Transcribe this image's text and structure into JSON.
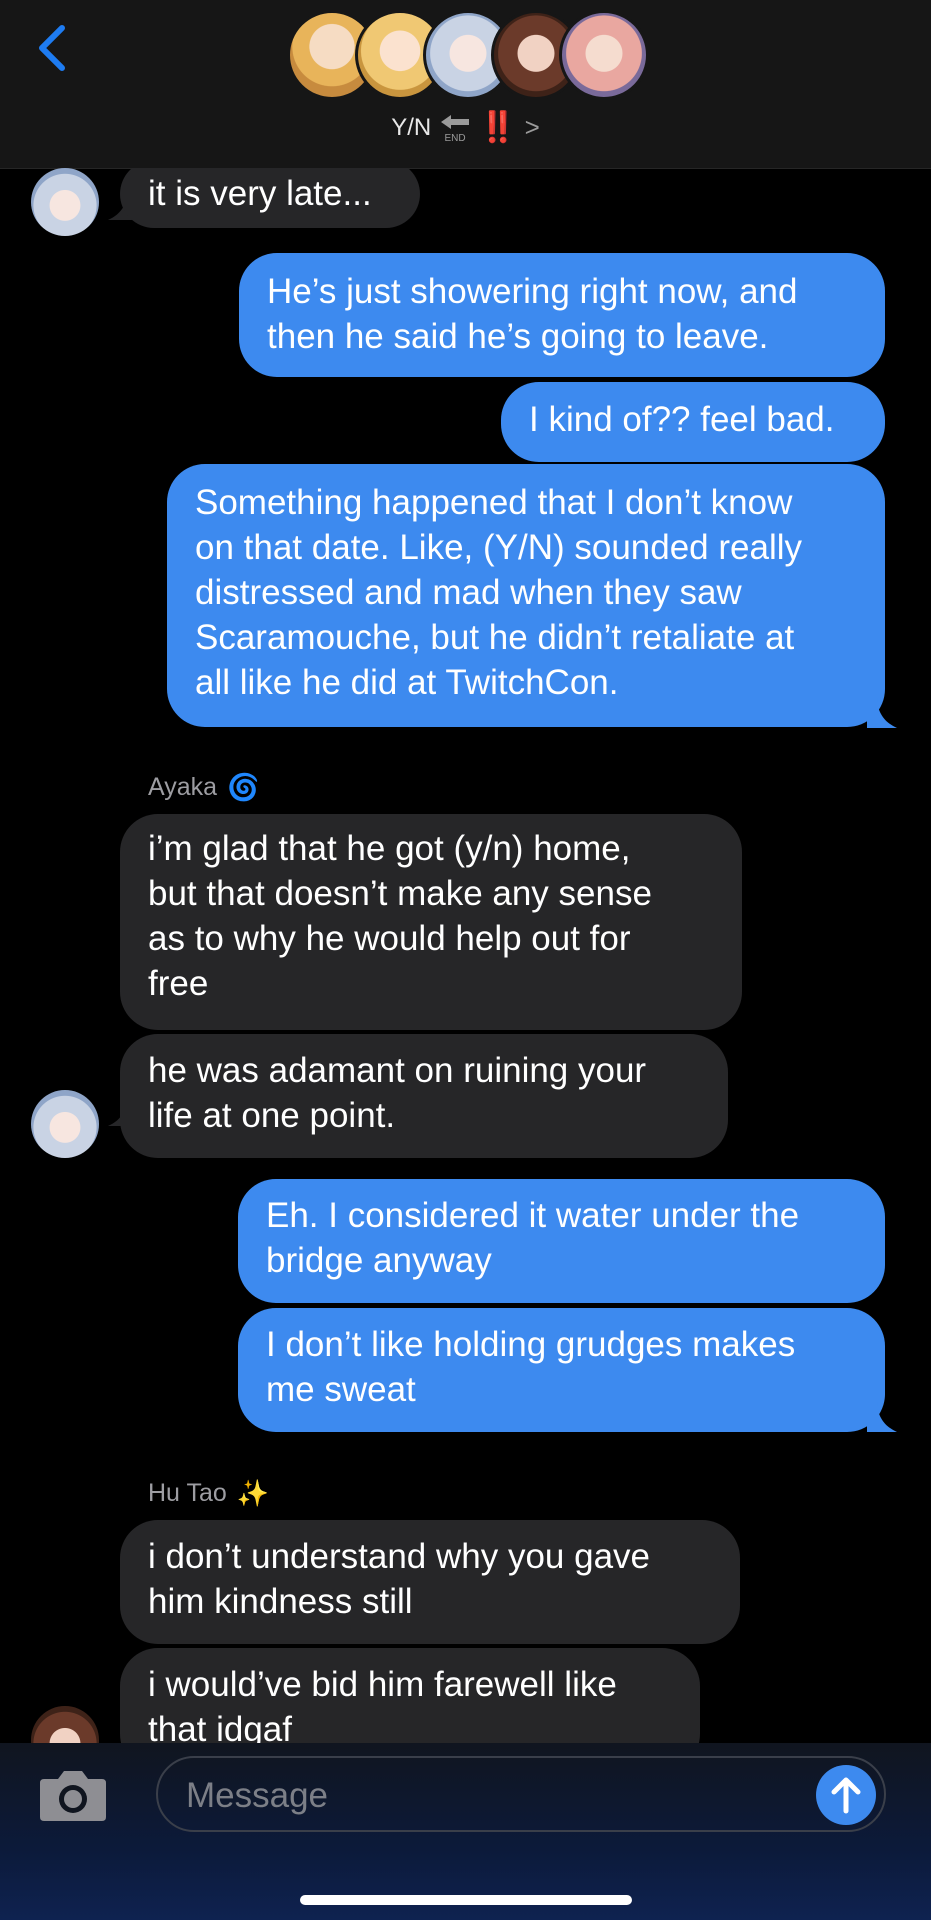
{
  "header": {
    "title": "Y/N",
    "end_label": "END",
    "alert": "‼️",
    "chevron": ">",
    "accent": "#1e7cf2"
  },
  "messages": [
    {
      "dir": "in",
      "text": "it is very late..."
    },
    {
      "dir": "out",
      "text": "He’s just showering right now, and\nthen he said he’s going to leave."
    },
    {
      "dir": "out",
      "text": "I kind of?? feel bad."
    },
    {
      "dir": "out",
      "text": "Something happened that I don’t know\non that date. Like, (Y/N) sounded really\ndistressed and mad when they saw\nScaramouche, but he didn’t retaliate at\nall like he did at TwitchCon."
    },
    {
      "sender": "Ayaka",
      "sender_emoji": "🌀"
    },
    {
      "dir": "in",
      "text": "i’m glad that he got (y/n) home,\nbut that doesn’t make any sense\nas to why he would help out for\nfree"
    },
    {
      "dir": "in",
      "text": "he was adamant on ruining your\nlife at one point."
    },
    {
      "dir": "out",
      "text": "Eh. I considered it water under the\nbridge anyway"
    },
    {
      "dir": "out",
      "text": "I don’t like holding grudges makes\nme sweat"
    },
    {
      "sender": "Hu Tao",
      "sender_emoji": "✨"
    },
    {
      "dir": "in",
      "text": "i don’t understand why you gave\nhim kindness still"
    },
    {
      "dir": "in",
      "text": "i would’ve bid him farewell like\nthat idgaf"
    }
  ],
  "composer": {
    "placeholder": "Message"
  },
  "colors": {
    "outgoing_bubble": "#3d8aef",
    "incoming_bubble": "#262628",
    "background": "#000000"
  }
}
